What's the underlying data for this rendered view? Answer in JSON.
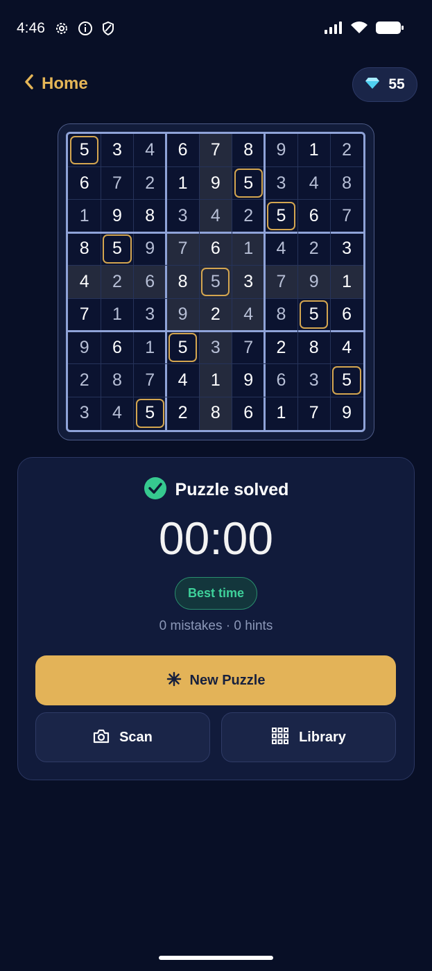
{
  "status_bar": {
    "time": "4:46",
    "icons": [
      "gear-icon",
      "info-icon",
      "shield-icon",
      "signal-icon",
      "wifi-icon",
      "battery-icon"
    ]
  },
  "header": {
    "back_label": "Home",
    "gem_count": "55"
  },
  "board": {
    "rows": [
      [
        "5",
        "3",
        "4",
        "6",
        "7",
        "8",
        "9",
        "1",
        "2"
      ],
      [
        "6",
        "7",
        "2",
        "1",
        "9",
        "5",
        "3",
        "4",
        "8"
      ],
      [
        "1",
        "9",
        "8",
        "3",
        "4",
        "2",
        "5",
        "6",
        "7"
      ],
      [
        "8",
        "5",
        "9",
        "7",
        "6",
        "1",
        "4",
        "2",
        "3"
      ],
      [
        "4",
        "2",
        "6",
        "8",
        "5",
        "3",
        "7",
        "9",
        "1"
      ],
      [
        "7",
        "1",
        "3",
        "9",
        "2",
        "4",
        "8",
        "5",
        "6"
      ],
      [
        "9",
        "6",
        "1",
        "5",
        "3",
        "7",
        "2",
        "8",
        "4"
      ],
      [
        "2",
        "8",
        "7",
        "4",
        "1",
        "9",
        "6",
        "3",
        "5"
      ],
      [
        "3",
        "4",
        "5",
        "2",
        "8",
        "6",
        "1",
        "7",
        "9"
      ]
    ],
    "selected_cell": {
      "row": 4,
      "col": 4
    },
    "highlighted_digit": "5",
    "dimmed": [
      [
        0,
        2
      ],
      [
        0,
        6
      ],
      [
        0,
        8
      ],
      [
        1,
        1
      ],
      [
        1,
        2
      ],
      [
        1,
        6
      ],
      [
        1,
        7
      ],
      [
        1,
        8
      ],
      [
        2,
        0
      ],
      [
        2,
        3
      ],
      [
        2,
        4
      ],
      [
        2,
        5
      ],
      [
        2,
        8
      ],
      [
        3,
        2
      ],
      [
        3,
        3
      ],
      [
        3,
        5
      ],
      [
        3,
        6
      ],
      [
        3,
        7
      ],
      [
        4,
        1
      ],
      [
        4,
        2
      ],
      [
        4,
        4
      ],
      [
        4,
        6
      ],
      [
        4,
        7
      ],
      [
        5,
        1
      ],
      [
        5,
        2
      ],
      [
        5,
        3
      ],
      [
        5,
        5
      ],
      [
        5,
        6
      ],
      [
        6,
        0
      ],
      [
        6,
        2
      ],
      [
        6,
        4
      ],
      [
        6,
        5
      ],
      [
        7,
        0
      ],
      [
        7,
        1
      ],
      [
        7,
        2
      ],
      [
        7,
        6
      ],
      [
        7,
        7
      ],
      [
        8,
        0
      ],
      [
        8,
        1
      ]
    ]
  },
  "result": {
    "status_text": "Puzzle solved",
    "timer": "00:00",
    "badge": "Best time",
    "stats": "0 mistakes · 0 hints"
  },
  "actions": {
    "new_puzzle": "New Puzzle",
    "scan": "Scan",
    "library": "Library"
  },
  "colors": {
    "background": "#080f26",
    "accent": "#e3b358",
    "success": "#3ed19a",
    "card": "#111b3b"
  }
}
